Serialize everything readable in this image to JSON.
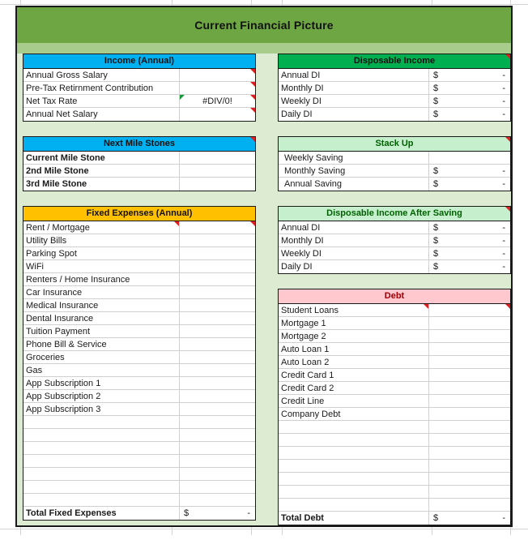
{
  "title": "Current Financial Picture",
  "accent_colors": {
    "title_banner": "#6FA644",
    "title_substrip": "#A8CC8C",
    "panel_background": "#DEEBD3",
    "income_header": "#00B0F0",
    "milestones_header": "#00B0F0",
    "disposable_income_header": "#00B050",
    "fixed_expenses_header": "#FFC000",
    "stack_up_header": "#C6EFCE",
    "dia_saving_header": "#C6EFCE",
    "debt_header": "#FFC7CE",
    "comment_flag": "#E02020",
    "error_flag": "#1A9A3C"
  },
  "currency_symbol": "$",
  "empty_amount": "-",
  "blocks": {
    "income": {
      "header": "Income (Annual)",
      "rows": [
        {
          "label": "Annual Gross Salary",
          "value": ""
        },
        {
          "label": "Pre-Tax Retirnment Contribution",
          "value": ""
        },
        {
          "label": "Net Tax Rate",
          "value": "#DIV/0!"
        },
        {
          "label": "Annual Net Salary",
          "value": ""
        }
      ]
    },
    "disposable_income": {
      "header": "Disposable Income",
      "rows": [
        {
          "label": "Annual DI",
          "symbol": "$",
          "amount": "-"
        },
        {
          "label": "Monthly DI",
          "symbol": "$",
          "amount": "-"
        },
        {
          "label": "Weekly DI",
          "symbol": "$",
          "amount": "-"
        },
        {
          "label": "Daily DI",
          "symbol": "$",
          "amount": "-"
        }
      ]
    },
    "milestones": {
      "header": "Next Mile Stones",
      "rows": [
        {
          "label": "Current Mile Stone",
          "value": ""
        },
        {
          "label": "2nd Mile Stone",
          "value": ""
        },
        {
          "label": "3rd Mile Stone",
          "value": ""
        }
      ]
    },
    "stack_up": {
      "header": "Stack Up",
      "rows": [
        {
          "label": "Weekly Saving",
          "symbol": "",
          "amount": ""
        },
        {
          "label": "Monthly Saving",
          "symbol": "$",
          "amount": "-"
        },
        {
          "label": "Annual Saving",
          "symbol": "$",
          "amount": "-"
        }
      ]
    },
    "fixed_expenses": {
      "header": "Fixed Expenses (Annual)",
      "rows": [
        {
          "label": "Rent / Mortgage",
          "value": ""
        },
        {
          "label": "Utility Bills",
          "value": ""
        },
        {
          "label": "Parking Spot",
          "value": ""
        },
        {
          "label": "WiFi",
          "value": ""
        },
        {
          "label": "Renters / Home Insurance",
          "value": ""
        },
        {
          "label": "Car Insurance",
          "value": ""
        },
        {
          "label": "Medical Insurance",
          "value": ""
        },
        {
          "label": "Dental Insurance",
          "value": ""
        },
        {
          "label": "Tuition Payment",
          "value": ""
        },
        {
          "label": "Phone Bill & Service",
          "value": ""
        },
        {
          "label": "Groceries",
          "value": ""
        },
        {
          "label": "Gas",
          "value": ""
        },
        {
          "label": "App Subscription 1",
          "value": ""
        },
        {
          "label": "App Subscription 2",
          "value": ""
        },
        {
          "label": "App Subscription 3",
          "value": ""
        },
        {
          "label": "",
          "value": ""
        },
        {
          "label": "",
          "value": ""
        },
        {
          "label": "",
          "value": ""
        },
        {
          "label": "",
          "value": ""
        },
        {
          "label": "",
          "value": ""
        },
        {
          "label": "",
          "value": ""
        },
        {
          "label": "",
          "value": ""
        }
      ],
      "total": {
        "label": "Total Fixed Expenses",
        "symbol": "$",
        "amount": "-"
      }
    },
    "dia_saving": {
      "header": "Disposable Income After Saving",
      "rows": [
        {
          "label": "Annual DI",
          "symbol": "$",
          "amount": "-"
        },
        {
          "label": "Monthly DI",
          "symbol": "$",
          "amount": "-"
        },
        {
          "label": "Weekly DI",
          "symbol": "$",
          "amount": "-"
        },
        {
          "label": "Daily DI",
          "symbol": "$",
          "amount": "-"
        }
      ]
    },
    "debt": {
      "header": "Debt",
      "rows": [
        {
          "label": "Student Loans",
          "value": ""
        },
        {
          "label": "Mortgage 1",
          "value": ""
        },
        {
          "label": "Mortgage 2",
          "value": ""
        },
        {
          "label": "Auto Loan 1",
          "value": ""
        },
        {
          "label": "Auto Loan 2",
          "value": ""
        },
        {
          "label": "Credit Card 1",
          "value": ""
        },
        {
          "label": "Credit Card 2",
          "value": ""
        },
        {
          "label": "Credit Line",
          "value": ""
        },
        {
          "label": "Company Debt",
          "value": ""
        },
        {
          "label": "",
          "value": ""
        },
        {
          "label": "",
          "value": ""
        },
        {
          "label": "",
          "value": ""
        },
        {
          "label": "",
          "value": ""
        },
        {
          "label": "",
          "value": ""
        },
        {
          "label": "",
          "value": ""
        },
        {
          "label": "",
          "value": ""
        }
      ],
      "total": {
        "label": "Total Debt",
        "symbol": "$",
        "amount": "-"
      }
    }
  }
}
